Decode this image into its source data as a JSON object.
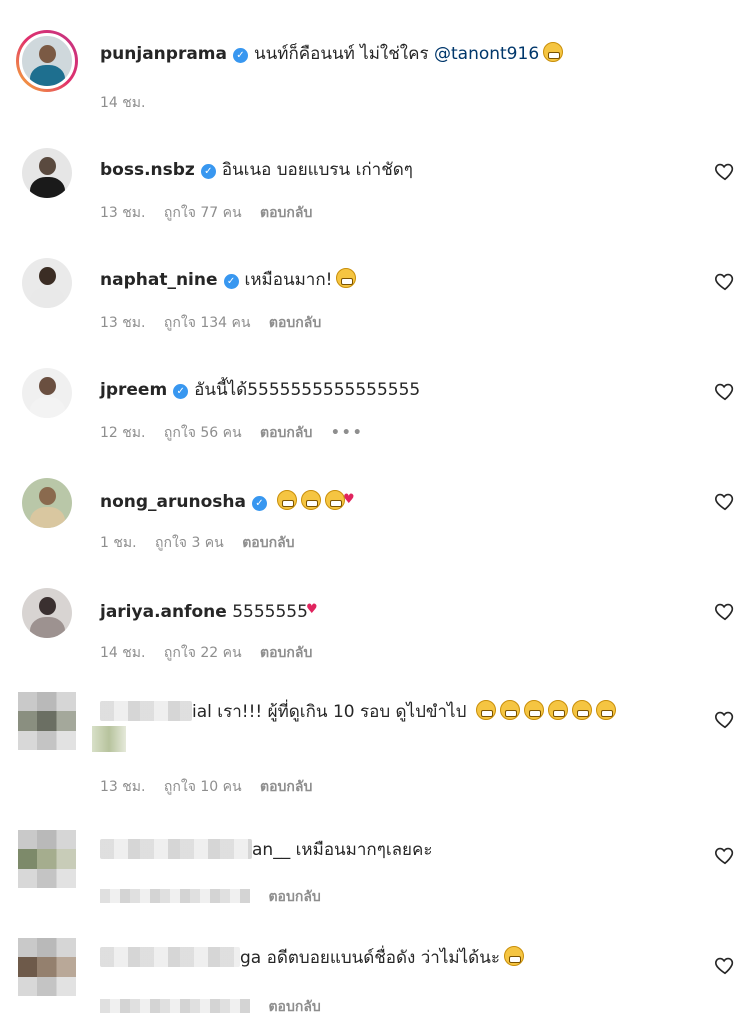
{
  "caption": {
    "username": "punjanprama",
    "text": "นนท์ก็คือนนท์ ไม่ใช่ใคร",
    "mention": "@tanont916",
    "time": "14 ชม."
  },
  "comments": [
    {
      "username": "boss.nsbz",
      "text": "อินเนอ บอยแบรน เก่าชัดๆ",
      "time": "13 ชม.",
      "likes": "ถูกใจ 77 คน",
      "reply": "ตอบกลับ"
    },
    {
      "username": "naphat_nine",
      "text": "เหมือนมาก!",
      "time": "13 ชม.",
      "likes": "ถูกใจ 134 คน",
      "reply": "ตอบกลับ"
    },
    {
      "username": "jpreem",
      "text": "อันนี้ได้5555555555555555",
      "time": "12 ชม.",
      "likes": "ถูกใจ 56 คน",
      "reply": "ตอบกลับ",
      "more": "•••"
    },
    {
      "username": "nong_arunosha",
      "text": "",
      "time": "1 ชม.",
      "likes": "ถูกใจ 3 คน",
      "reply": "ตอบกลับ"
    },
    {
      "username": "jariya.anfone",
      "text": "5555555",
      "time": "14 ชม.",
      "likes": "ถูกใจ 22 คน",
      "reply": "ตอบกลับ"
    },
    {
      "username": "",
      "text": "ial เรา!!! ผู้ที่ดูเกิน 10 รอบ ดูไปขำไป",
      "time": "13 ชม.",
      "likes": "ถูกใจ 10 คน",
      "reply": "ตอบกลับ"
    },
    {
      "username": "",
      "text": "an__ เหมือนมากๆเลยคะ",
      "time": "",
      "likes": "",
      "reply": "ตอบกลับ"
    },
    {
      "username": "",
      "text": "ga อดีตบอยแบนด์ชื่อดัง ว่าไม่ได้นะ",
      "time": "",
      "likes": "",
      "reply": "ตอบกลับ"
    }
  ],
  "colors": {
    "verified": "#3897f0",
    "mention": "#00376b",
    "meta": "#8e8e8e"
  },
  "icons": {
    "verified": "verified-badge-icon",
    "like": "heart-outline-icon",
    "emoji": "grinning-squinting-face-icon"
  }
}
